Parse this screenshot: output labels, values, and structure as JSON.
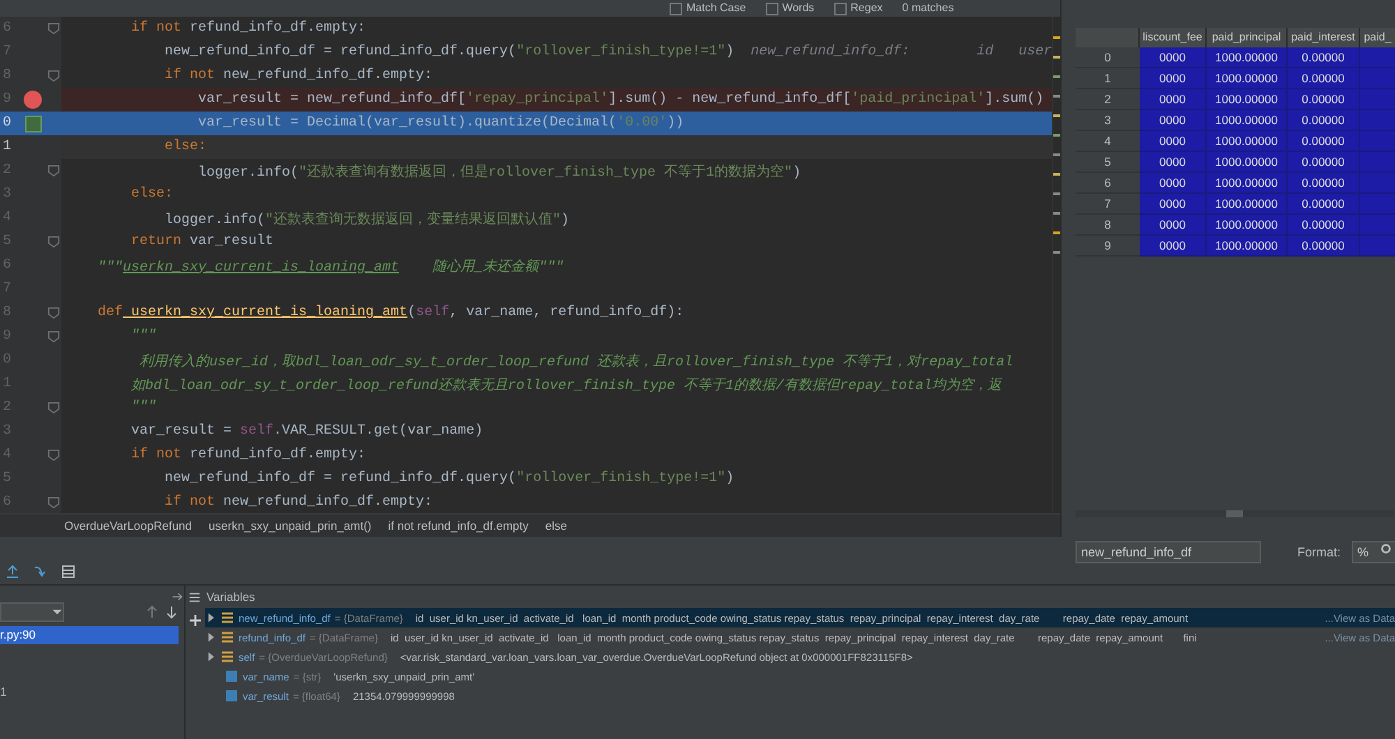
{
  "search_bar": {
    "options": [
      {
        "label": "Match Case",
        "checked": false
      },
      {
        "label": "Words",
        "checked": false
      },
      {
        "label": "Regex",
        "checked": false
      }
    ],
    "result": "0 matches"
  },
  "editor": {
    "lines": [
      {
        "number": "6",
        "kind": "normal",
        "fold": true,
        "segments": [
          {
            "text": "    if not",
            "kind": "keyword"
          },
          {
            "text": " refund_info_df.empty:",
            "kind": "plain"
          }
        ]
      },
      {
        "number": "7",
        "kind": "normal",
        "fold": false,
        "segments": [
          {
            "text": "        new_refund_info_df = refund_info_df.query(",
            "kind": "plain"
          },
          {
            "text": "\"rollover_finish_type!=1\"",
            "kind": "string"
          },
          {
            "text": ")",
            "kind": "plain"
          },
          {
            "text": "  new_refund_info_df:        id   user",
            "kind": "hint"
          }
        ]
      },
      {
        "number": "8",
        "kind": "normal",
        "fold": true,
        "segments": [
          {
            "text": "        if not",
            "kind": "keyword"
          },
          {
            "text": " new_refund_info_df.empty:",
            "kind": "plain"
          }
        ]
      },
      {
        "number": "9",
        "kind": "breakpoint",
        "fold": false,
        "segments": [
          {
            "text": "            var_result = new_refund_info_df[",
            "kind": "plain"
          },
          {
            "text": "'repay_principal'",
            "kind": "string"
          },
          {
            "text": "].sum() - new_refund_info_df[",
            "kind": "plain"
          },
          {
            "text": "'paid_principal'",
            "kind": "string"
          },
          {
            "text": "].sum()",
            "kind": "plain"
          }
        ]
      },
      {
        "number": "0",
        "kind": "execution",
        "fold": false,
        "segments": [
          {
            "text": "            var_result = Decimal(var_result).quantize(Decimal(",
            "kind": "plain"
          },
          {
            "text": "'0.00'",
            "kind": "string"
          },
          {
            "text": "))",
            "kind": "plain"
          }
        ]
      },
      {
        "number": "1",
        "kind": "caret",
        "fold": false,
        "segments": [
          {
            "text": "        else:",
            "kind": "keyword"
          }
        ]
      },
      {
        "number": "2",
        "kind": "normal",
        "fold": true,
        "segments": [
          {
            "text": "            logger.info(",
            "kind": "plain"
          },
          {
            "text": "\"还款表查询有数据返回，但是rollover_finish_type 不等于1的数据为空\"",
            "kind": "string"
          },
          {
            "text": ")",
            "kind": "plain"
          }
        ]
      },
      {
        "number": "3",
        "kind": "normal",
        "fold": false,
        "segments": [
          {
            "text": "    else:",
            "kind": "keyword"
          }
        ]
      },
      {
        "number": "4",
        "kind": "normal",
        "fold": false,
        "segments": [
          {
            "text": "        logger.info(",
            "kind": "plain"
          },
          {
            "text": "\"还款表查询无数据返回，变量结果返回默认值\"",
            "kind": "string"
          },
          {
            "text": ")",
            "kind": "plain"
          }
        ]
      },
      {
        "number": "5",
        "kind": "normal",
        "fold": true,
        "segments": [
          {
            "text": "    return",
            "kind": "keyword"
          },
          {
            "text": " var_result",
            "kind": "plain"
          }
        ]
      },
      {
        "number": "6",
        "kind": "normal",
        "fold": false,
        "segments": [
          {
            "text": "\"\"\"",
            "kind": "doc"
          },
          {
            "text": "userkn_sxy_current_is_loaning_amt",
            "kind": "link"
          },
          {
            "text": "    随心用_未还金额\"\"\"",
            "kind": "doc"
          }
        ]
      },
      {
        "number": "7",
        "kind": "normal",
        "fold": false
      },
      {
        "number": "8",
        "kind": "normal",
        "fold": true,
        "segments": [
          {
            "text": "def",
            "kind": "keyword"
          },
          {
            "text": " userkn_sxy_current_is_loaning_amt",
            "kind": "func"
          },
          {
            "text": "(",
            "kind": "plain"
          },
          {
            "text": "self",
            "kind": "self"
          },
          {
            "text": ", var_name, refund_info_df):",
            "kind": "plain"
          }
        ]
      },
      {
        "number": "9",
        "kind": "normal",
        "fold": true,
        "segments": [
          {
            "text": "    \"\"\"",
            "kind": "doc"
          }
        ]
      },
      {
        "number": "0",
        "kind": "normal",
        "fold": false,
        "segments": [
          {
            "text": "     利用传入的user_id，取bdl_loan_odr_sy_t_order_loop_refund 还款表，且rollover_finish_type 不等于1，对repay_total",
            "kind": "doc"
          }
        ]
      },
      {
        "number": "1",
        "kind": "normal",
        "fold": false,
        "segments": [
          {
            "text": "    如bdl_loan_odr_sy_t_order_loop_refund还款表无且rollover_finish_type 不等于1的数据/有数据但repay_total均为空，返",
            "kind": "doc"
          }
        ]
      },
      {
        "number": "2",
        "kind": "normal",
        "fold": true,
        "segments": [
          {
            "text": "    \"\"\"",
            "kind": "doc"
          }
        ]
      },
      {
        "number": "3",
        "kind": "normal",
        "fold": false,
        "segments": [
          {
            "text": "    var_result = ",
            "kind": "plain"
          },
          {
            "text": "self",
            "kind": "self"
          },
          {
            "text": ".VAR_RESULT.get(var_name)",
            "kind": "plain"
          }
        ]
      },
      {
        "number": "4",
        "kind": "normal",
        "fold": true,
        "segments": [
          {
            "text": "    if not",
            "kind": "keyword"
          },
          {
            "text": " refund_info_df.empty:",
            "kind": "plain"
          }
        ]
      },
      {
        "number": "5",
        "kind": "normal",
        "fold": false,
        "segments": [
          {
            "text": "        new_refund_info_df = refund_info_df.query(",
            "kind": "plain"
          },
          {
            "text": "\"rollover_finish_type!=1\"",
            "kind": "string"
          },
          {
            "text": ")",
            "kind": "plain"
          }
        ]
      },
      {
        "number": "6",
        "kind": "normal",
        "fold": true,
        "segments": [
          {
            "text": "        if not",
            "kind": "keyword"
          },
          {
            "text": " new_refund_info_df.empty:",
            "kind": "plain"
          }
        ]
      }
    ]
  },
  "breadcrumb": [
    "OverdueVarLoopRefund",
    "userkn_sxy_unpaid_prin_amt()",
    "if not refund_info_df.empty",
    "else"
  ],
  "dataframe_view": {
    "columns": [
      "liscount_fee",
      "paid_principal",
      "paid_interest",
      "paid_"
    ],
    "rows": [
      {
        "index": "0",
        "selected": true,
        "cells": [
          "0000",
          "1000.00000",
          "0.00000"
        ]
      },
      {
        "index": "1",
        "selected": true,
        "cells": [
          "0000",
          "1000.00000",
          "0.00000"
        ]
      },
      {
        "index": "2",
        "selected": true,
        "cells": [
          "0000",
          "1000.00000",
          "0.00000"
        ]
      },
      {
        "index": "3",
        "selected": true,
        "cells": [
          "0000",
          "1000.00000",
          "0.00000"
        ]
      },
      {
        "index": "4",
        "selected": true,
        "cells": [
          "0000",
          "1000.00000",
          "0.00000"
        ]
      },
      {
        "index": "5",
        "selected": true,
        "cells": [
          "0000",
          "1000.00000",
          "0.00000"
        ]
      },
      {
        "index": "6",
        "selected": true,
        "cells": [
          "0000",
          "1000.00000",
          "0.00000"
        ]
      },
      {
        "index": "7",
        "selected": true,
        "cells": [
          "0000",
          "1000.00000",
          "0.00000"
        ]
      },
      {
        "index": "8",
        "selected": true,
        "cells": [
          "0000",
          "1000.00000",
          "0.00000"
        ]
      },
      {
        "index": "9",
        "selected": true,
        "cells": [
          "0000",
          "1000.00000",
          "0.00000"
        ]
      }
    ],
    "name_field": "new_refund_info_df",
    "format_label": "Format:",
    "format_field": "%"
  },
  "debugger": {
    "variables_title": "Variables",
    "frames": [
      {
        "label": "r.py:90",
        "selected": true
      },
      {
        "label": "1",
        "selected": false
      }
    ],
    "variables": [
      {
        "kind": "object",
        "selected": true,
        "name": "new_refund_info_df",
        "type": " = {DataFrame}",
        "value": "id  user_id kn_user_id  activate_id   loan_id  month product_code owing_status repay_status  repay_principal  repay_interest  day_rate        repay_date  repay_amount",
        "action": "...View as Data"
      },
      {
        "kind": "object",
        "selected": false,
        "name": "refund_info_df",
        "type": " = {DataFrame}",
        "value": "id  user_id kn_user_id  activate_id   loan_id  month product_code owing_status repay_status  repay_principal  repay_interest  day_rate        repay_date  repay_amount       fini",
        "action": "...View as Data"
      },
      {
        "kind": "object",
        "selected": false,
        "name": "self",
        "type": " = {OverdueVarLoopRefund}",
        "value": "<var.risk_standard_var.loan_vars.loan_var_overdue.OverdueVarLoopRefund object at 0x000001FF823115F8>"
      },
      {
        "kind": "scalar",
        "selected": false,
        "name": "var_name",
        "type": " = {str}",
        "value": "'userkn_sxy_unpaid_prin_amt'"
      },
      {
        "kind": "scalar",
        "selected": false,
        "name": "var_result",
        "type": " = {float64}",
        "value": "21354.079999999998"
      }
    ]
  }
}
